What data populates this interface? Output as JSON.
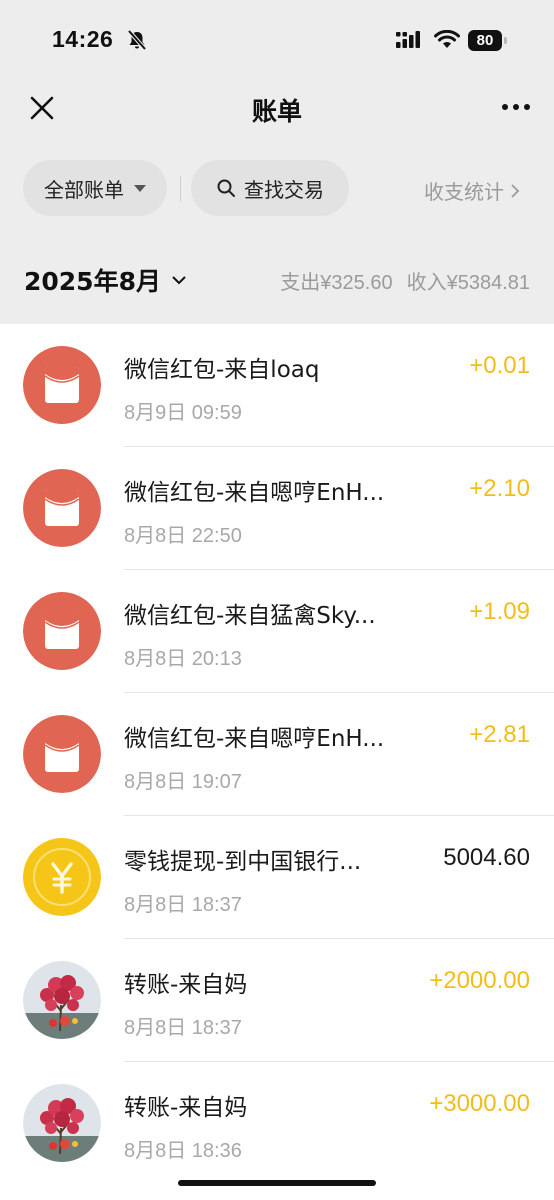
{
  "status_bar": {
    "time": "14:26",
    "battery": "80",
    "icons": [
      "bell-muted-icon",
      "signal-icon",
      "wifi-icon",
      "battery-icon"
    ]
  },
  "nav": {
    "title": "账单",
    "left_icon": "close-icon",
    "right_icon": "more-icon"
  },
  "filters": {
    "all_bills": "全部账单",
    "search": "查找交易",
    "stats": "收支统计"
  },
  "month": {
    "label": "2025年8月",
    "expense": "支出¥325.60",
    "income": "收入¥5384.81"
  },
  "colors": {
    "red_packet": "#e06553",
    "income_amount": "#f4bc1a",
    "coin": "#f5c518"
  },
  "transactions": [
    {
      "title": "微信红包-来自loaq",
      "time": "8月9日 09:59",
      "amount": "+0.01",
      "icon": "red-packet-icon",
      "type": "income"
    },
    {
      "title": "微信红包-来自嗯哼EnH...",
      "time": "8月8日 22:50",
      "amount": "+2.10",
      "icon": "red-packet-icon",
      "type": "income"
    },
    {
      "title": "微信红包-来自猛禽Sky...",
      "time": "8月8日 20:13",
      "amount": "+1.09",
      "icon": "red-packet-icon",
      "type": "income"
    },
    {
      "title": "微信红包-来自嗯哼EnH...",
      "time": "8月8日 19:07",
      "amount": "+2.81",
      "icon": "red-packet-icon",
      "type": "income"
    },
    {
      "title": "零钱提现-到中国银行...",
      "time": "8月8日 18:37",
      "amount": "5004.60",
      "icon": "yuan-coin-icon",
      "type": "neutral"
    },
    {
      "title": "转账-来自妈",
      "time": "8月8日 18:37",
      "amount": "+2000.00",
      "icon": "contact-avatar",
      "type": "income"
    },
    {
      "title": "转账-来自妈",
      "time": "8月8日 18:36",
      "amount": "+3000.00",
      "icon": "contact-avatar",
      "type": "income"
    }
  ]
}
